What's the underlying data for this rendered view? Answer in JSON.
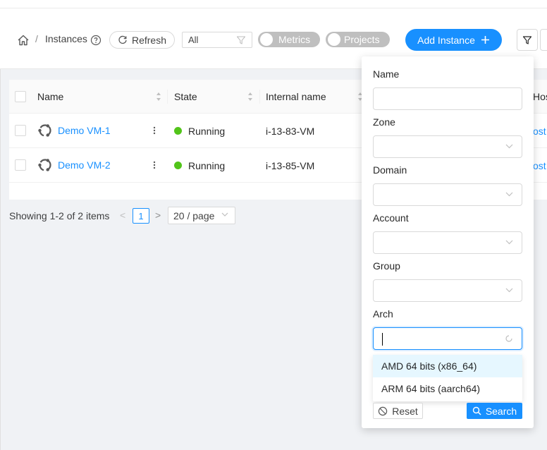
{
  "breadcrumb": {
    "separator": "/",
    "title": "Instances"
  },
  "toolbar": {
    "refresh_label": "Refresh",
    "filter_select_value": "All",
    "metrics_label": "Metrics",
    "projects_label": "Projects",
    "add_instance_label": "Add Instance"
  },
  "table": {
    "columns": [
      "Name",
      "State",
      "Internal name",
      "Host"
    ],
    "rows": [
      {
        "name": "Demo VM-1",
        "state": "Running",
        "internal_name": "i-13-83-VM",
        "host": "ost"
      },
      {
        "name": "Demo VM-2",
        "state": "Running",
        "internal_name": "i-13-85-VM",
        "host": "ost"
      }
    ]
  },
  "pagination": {
    "total_text": "Showing 1-2 of 2 items",
    "prev": "<",
    "current_page": "1",
    "next": ">",
    "page_size": "20 / page"
  },
  "filter_panel": {
    "fields": [
      {
        "label": "Name",
        "value": ""
      },
      {
        "label": "Zone",
        "value": ""
      },
      {
        "label": "Domain",
        "value": ""
      },
      {
        "label": "Account",
        "value": ""
      },
      {
        "label": "Group",
        "value": ""
      },
      {
        "label": "Arch",
        "value": ""
      }
    ],
    "arch_options": [
      "AMD 64 bits (x86_64)",
      "ARM 64 bits (aarch64)"
    ],
    "reset_label": "Reset",
    "search_label": "Search"
  },
  "colors": {
    "primary": "#1890ff",
    "running": "#52c41a",
    "toggle_off": "#bfbfbf"
  }
}
